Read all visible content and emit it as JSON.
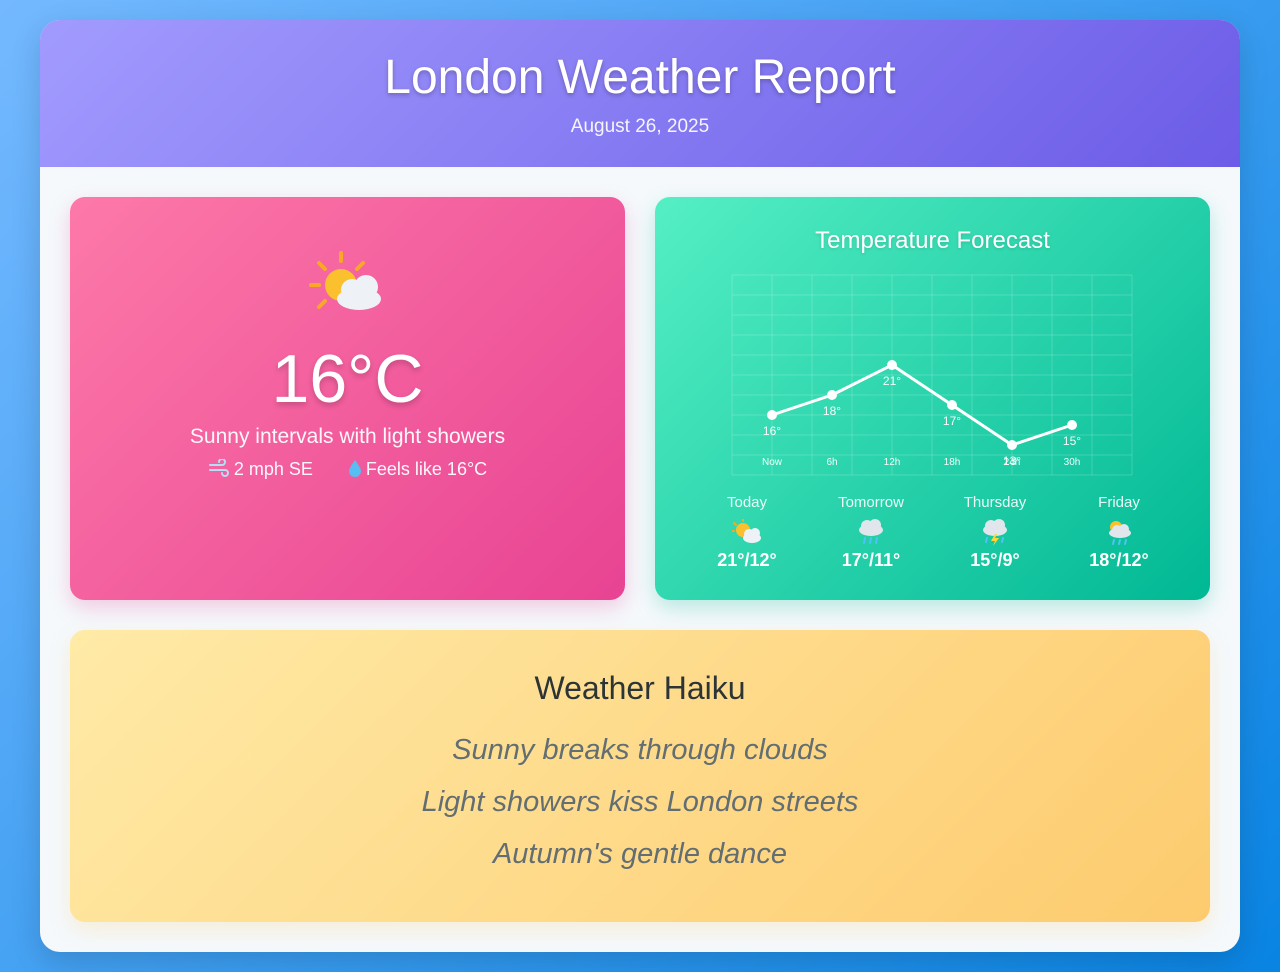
{
  "header": {
    "title": "London Weather Report",
    "date": "August 26, 2025"
  },
  "current": {
    "icon": "sun-behind-cloud-icon",
    "temperature": "16°C",
    "description": "Sunny intervals with light showers",
    "wind": "2 mph SE",
    "feels_like": "Feels like 16°C"
  },
  "forecast": {
    "title": "Temperature Forecast",
    "days": [
      {
        "name": "Today",
        "icon": "sun-behind-cloud-icon",
        "range": "21°/12°"
      },
      {
        "name": "Tomorrow",
        "icon": "rain-cloud-icon",
        "range": "17°/11°"
      },
      {
        "name": "Thursday",
        "icon": "thunder-cloud-icon",
        "range": "15°/9°"
      },
      {
        "name": "Friday",
        "icon": "sun-behind-rain-cloud-icon",
        "range": "18°/12°"
      }
    ]
  },
  "chart_data": {
    "type": "line",
    "categories": [
      "Now",
      "6h",
      "12h",
      "18h",
      "24h",
      "30h"
    ],
    "values": [
      16,
      18,
      21,
      17,
      13,
      15
    ],
    "data_labels": [
      "16°",
      "18°",
      "21°",
      "17°",
      "13°",
      "15°"
    ],
    "grid": true,
    "line_color": "#ffffff"
  },
  "haiku": {
    "title": "Weather Haiku",
    "lines": [
      "Sunny breaks through clouds",
      "Light showers kiss London streets",
      "Autumn's gentle dance"
    ]
  }
}
